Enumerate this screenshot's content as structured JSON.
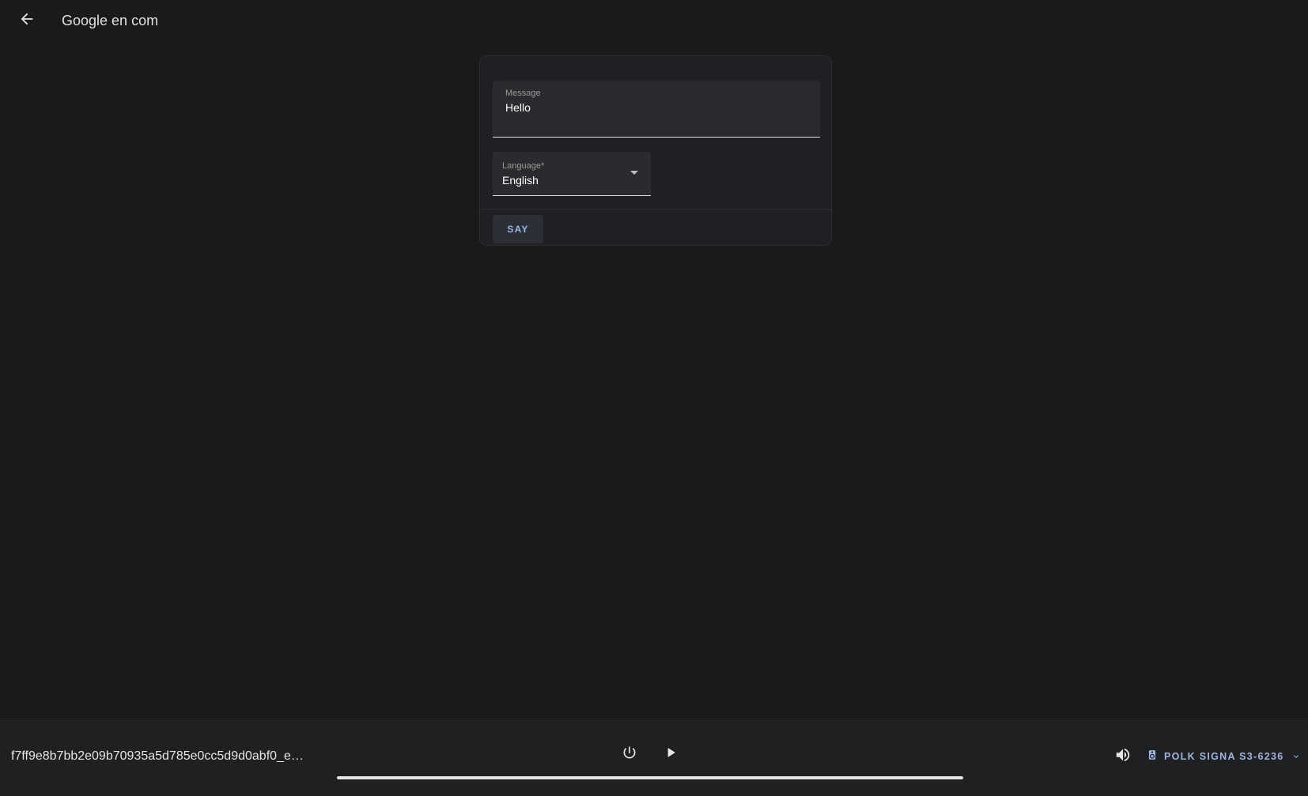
{
  "header": {
    "title": "Google en com",
    "back_icon": "arrow-left-icon"
  },
  "form": {
    "message": {
      "label": "Message",
      "value": "Hello"
    },
    "language": {
      "label": "Language*",
      "value": "English"
    },
    "say_label": "SAY"
  },
  "player": {
    "media_title": "f7ff9e8b7bb2e09b70935a5d785e0cc5d9d0abf0_e…",
    "progress": 1.0,
    "device_label": "POLK SIGNA S3-6236",
    "icons": {
      "power": "power-icon",
      "play": "play-icon",
      "volume": "volume-icon",
      "speaker": "speaker-icon",
      "caret": "chevron-down-icon"
    }
  },
  "colors": {
    "background": "#1a1a1b",
    "card": "#1f2023",
    "field": "#2a2b2e",
    "accent": "#9fb4e0"
  }
}
